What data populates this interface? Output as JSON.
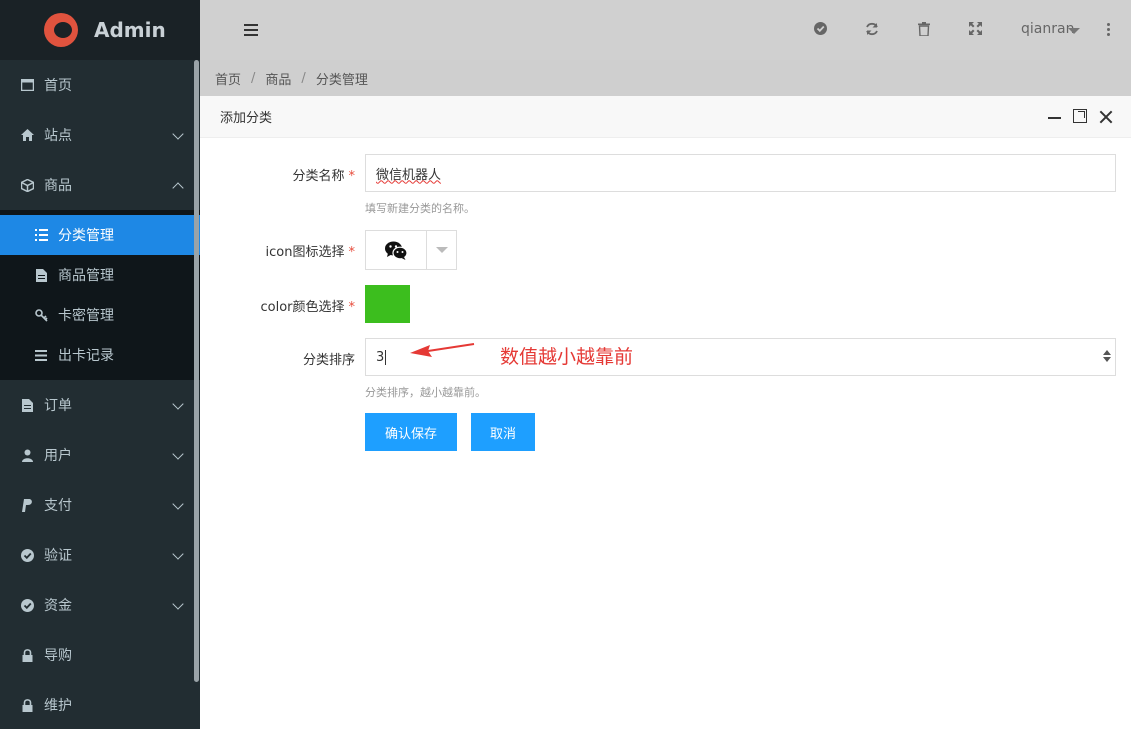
{
  "app": {
    "title": "Admin"
  },
  "sidebar": {
    "items": [
      {
        "label": "首页",
        "icon": "window-icon"
      },
      {
        "label": "站点",
        "icon": "home-icon"
      },
      {
        "label": "商品",
        "icon": "cube-icon"
      },
      {
        "label": "订单",
        "icon": "file-icon"
      },
      {
        "label": "用户",
        "icon": "user-icon"
      },
      {
        "label": "支付",
        "icon": "paypal-icon"
      },
      {
        "label": "验证",
        "icon": "check-circle-icon"
      },
      {
        "label": "资金",
        "icon": "check-circle-icon"
      },
      {
        "label": "导购",
        "icon": "lock-icon"
      },
      {
        "label": "维护",
        "icon": "lock-icon"
      }
    ],
    "sub_items": [
      {
        "label": "分类管理",
        "icon": "list-icon"
      },
      {
        "label": "商品管理",
        "icon": "file-icon"
      },
      {
        "label": "卡密管理",
        "icon": "key-icon"
      },
      {
        "label": "出卡记录",
        "icon": "bars-icon"
      }
    ]
  },
  "header": {
    "user": "qianran"
  },
  "breadcrumb": [
    "首页",
    "商品",
    "分类管理"
  ],
  "dialog": {
    "title": "添加分类",
    "name_label": "分类名称",
    "name_value": "微信机器人",
    "name_help": "填写新建分类的名称。",
    "icon_label": "icon图标选择",
    "color_label": "color颜色选择",
    "color_value": "#3cbe1e",
    "sort_label": "分类排序",
    "sort_value": "3",
    "sort_help": "分类排序，越小越靠前。",
    "save_label": "确认保存",
    "cancel_label": "取消",
    "required_mark": "*"
  },
  "annotation": {
    "text": "数值越小越靠前"
  },
  "colors": {
    "accent": "#1e88e5",
    "button": "#1e9fff",
    "annotation": "#e53935",
    "sidebar": "#222d32"
  }
}
